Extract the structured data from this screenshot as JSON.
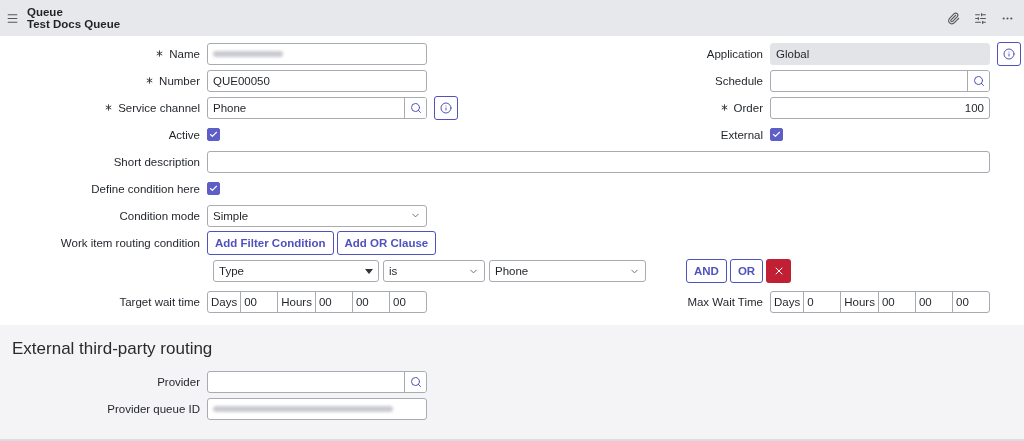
{
  "header": {
    "kind": "Queue",
    "title": "Test Docs Queue"
  },
  "left_fields": [
    {
      "kind": "text",
      "label": "Name",
      "required": true,
      "redacted": true
    },
    {
      "kind": "text",
      "label": "Number",
      "required": true,
      "value": "QUE00050"
    },
    {
      "kind": "lookup",
      "label": "Service channel",
      "required": true,
      "value": "Phone",
      "info": true
    },
    {
      "kind": "checkbox",
      "label": "Active",
      "checked": true
    }
  ],
  "right_fields": [
    {
      "kind": "readonly",
      "label": "Application",
      "value": "Global",
      "info": true
    },
    {
      "kind": "lookup",
      "label": "Schedule"
    },
    {
      "kind": "number",
      "label": "Order",
      "required": true,
      "value": "100"
    },
    {
      "kind": "checkbox",
      "label": "External",
      "checked": true
    }
  ],
  "short_description": {
    "label": "Short description"
  },
  "define_condition": {
    "label": "Define condition here",
    "checked": true
  },
  "condition_mode": {
    "label": "Condition mode",
    "value": "Simple"
  },
  "routing_condition": {
    "label": "Work item routing condition",
    "buttons": [
      "Add Filter Condition",
      "Add OR Clause"
    ],
    "field": "Type",
    "operator": "is",
    "value": "Phone",
    "actions": [
      "AND",
      "OR"
    ]
  },
  "target_wait_time": {
    "label": "Target wait time",
    "parts": [
      {
        "unit": "Days",
        "value": "00"
      },
      {
        "unit": "Hours",
        "value": "00"
      },
      {
        "value": "00"
      },
      {
        "value": "00"
      }
    ]
  },
  "max_wait_time": {
    "label": "Max Wait Time",
    "parts": [
      {
        "unit": "Days",
        "value": "0"
      },
      {
        "unit": "Hours",
        "value": "00"
      },
      {
        "value": "00"
      },
      {
        "value": "00"
      }
    ]
  },
  "external_section": {
    "title": "External third-party routing",
    "provider": {
      "label": "Provider"
    },
    "provider_queue_id": {
      "label": "Provider queue ID",
      "redacted": true
    }
  }
}
